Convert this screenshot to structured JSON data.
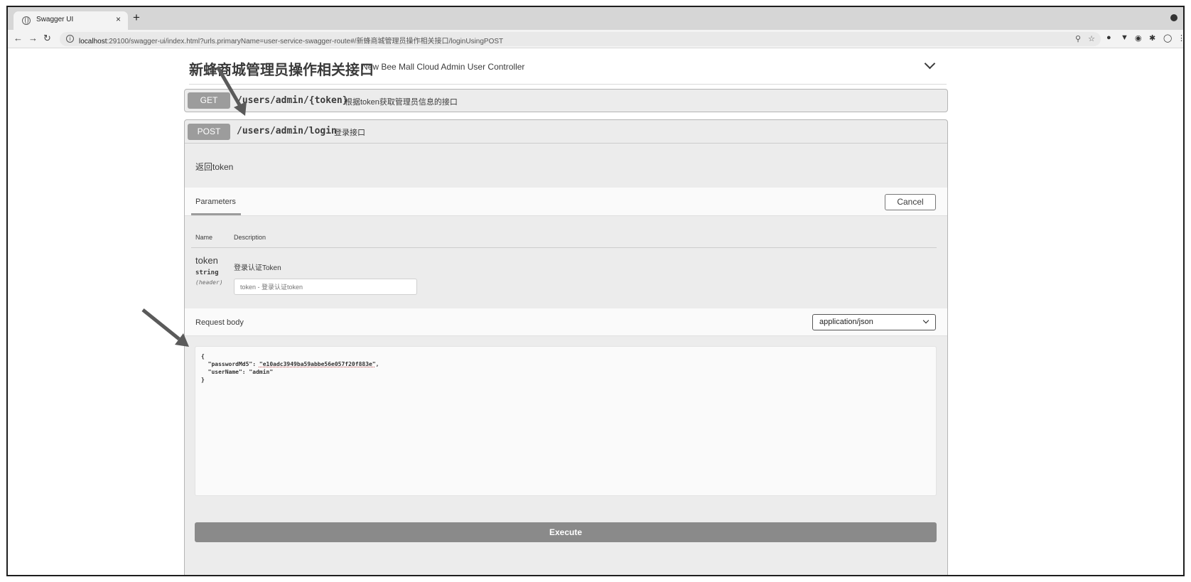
{
  "browser": {
    "tab_title": "Swagger UI",
    "tab_close": "×",
    "new_tab": "+",
    "url_host": "localhost",
    "url_rest": ":29100/swagger-ui/index.html?urls.primaryName=user-service-swagger-route#/新蜂商城管理员操作相关接口/loginUsingPOST"
  },
  "section": {
    "title": "新蜂商城管理员操作相关接口",
    "subtitle": "New Bee Mall Cloud Admin User Controller"
  },
  "operations": [
    {
      "method": "GET",
      "path": "/users/admin/{token}",
      "summary": "根据token获取管理员信息的接口"
    },
    {
      "method": "POST",
      "path": "/users/admin/login",
      "summary": "登录接口"
    }
  ],
  "post_detail": {
    "description": "返回token",
    "parameters_tab": "Parameters",
    "cancel_label": "Cancel",
    "col_name": "Name",
    "col_description": "Description",
    "param": {
      "name": "token",
      "type": "string",
      "in": "(header)",
      "description": "登录认证Token",
      "placeholder": "token - 登录认证token"
    },
    "request_body_label": "Request body",
    "content_type": "application/json",
    "body_open": "{",
    "body_line1_key": "  \"passwordMd5\": ",
    "body_line1_val": "\"e10adc3949ba59abbe56e057f20f883e\"",
    "body_line1_end": ",",
    "body_line2": "  \"userName\": \"admin\"",
    "body_close": "}",
    "execute_label": "Execute"
  }
}
